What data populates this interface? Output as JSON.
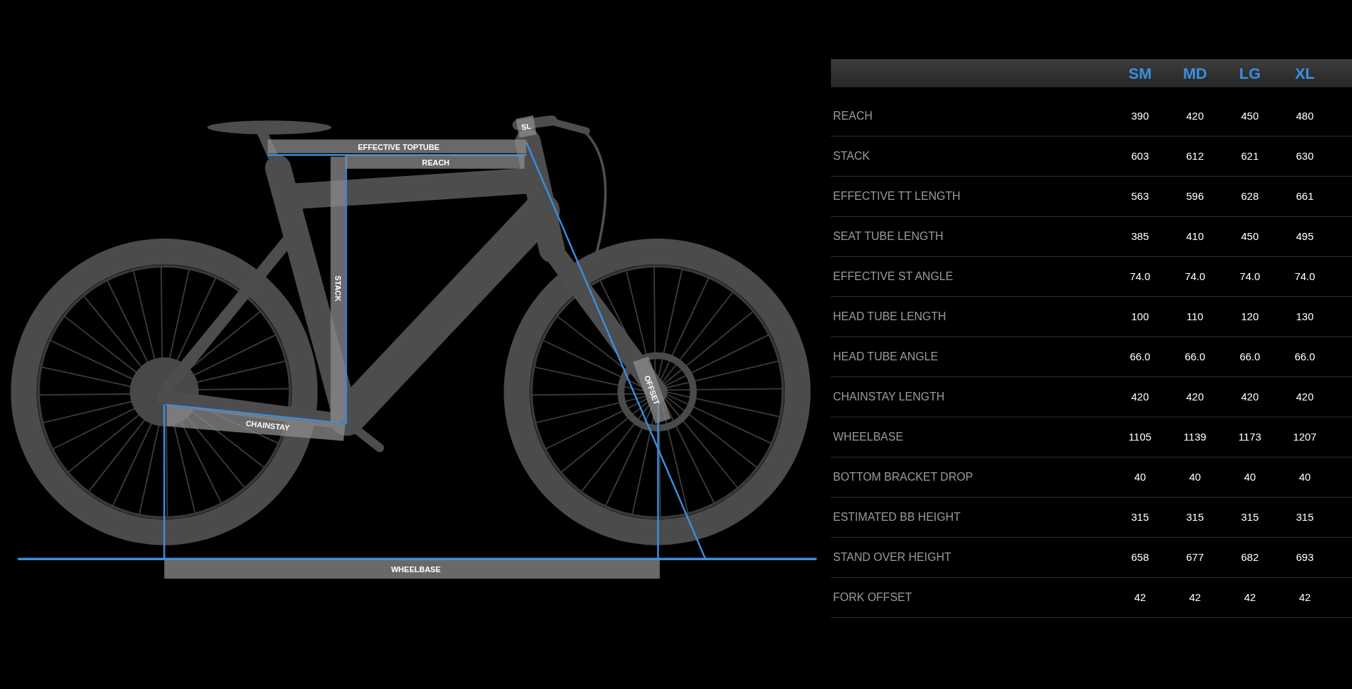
{
  "diagram": {
    "labels": [
      {
        "kind": "effective_toptube",
        "text": "EFFECTIVE TOPTUBE"
      },
      {
        "kind": "reach",
        "text": "REACH"
      },
      {
        "kind": "sl",
        "text": "SL"
      },
      {
        "kind": "stack",
        "text": "STACK"
      },
      {
        "kind": "offset",
        "text": "OFFSET"
      },
      {
        "kind": "chainstay",
        "text": "CHAINSTAY"
      },
      {
        "kind": "wheelbase",
        "text": "WHEELBASE"
      }
    ]
  },
  "table": {
    "columns": [
      "SM",
      "MD",
      "LG",
      "XL"
    ],
    "rows": [
      {
        "label": "REACH",
        "values": [
          "390",
          "420",
          "450",
          "480"
        ]
      },
      {
        "label": "STACK",
        "values": [
          "603",
          "612",
          "621",
          "630"
        ]
      },
      {
        "label": "EFFECTIVE TT LENGTH",
        "values": [
          "563",
          "596",
          "628",
          "661"
        ]
      },
      {
        "label": "SEAT TUBE LENGTH",
        "values": [
          "385",
          "410",
          "450",
          "495"
        ]
      },
      {
        "label": "EFFECTIVE ST ANGLE",
        "values": [
          "74.0",
          "74.0",
          "74.0",
          "74.0"
        ]
      },
      {
        "label": "HEAD TUBE LENGTH",
        "values": [
          "100",
          "110",
          "120",
          "130"
        ]
      },
      {
        "label": "HEAD TUBE ANGLE",
        "values": [
          "66.0",
          "66.0",
          "66.0",
          "66.0"
        ]
      },
      {
        "label": "CHAINSTAY LENGTH",
        "values": [
          "420",
          "420",
          "420",
          "420"
        ]
      },
      {
        "label": "WHEELBASE",
        "values": [
          "1105",
          "1139",
          "1173",
          "1207"
        ]
      },
      {
        "label": "BOTTOM BRACKET DROP",
        "values": [
          "40",
          "40",
          "40",
          "40"
        ]
      },
      {
        "label": "ESTIMATED BB HEIGHT",
        "values": [
          "315",
          "315",
          "315",
          "315"
        ]
      },
      {
        "label": "STAND OVER HEIGHT",
        "values": [
          "658",
          "677",
          "682",
          "693"
        ]
      },
      {
        "label": "FORK OFFSET",
        "values": [
          "42",
          "42",
          "42",
          "42"
        ]
      }
    ]
  }
}
